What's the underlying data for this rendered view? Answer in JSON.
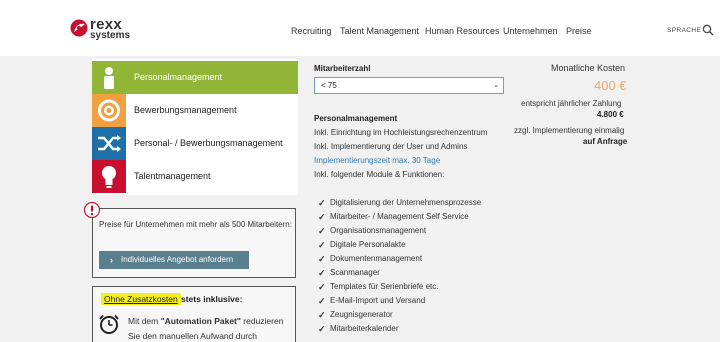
{
  "brand": {
    "name_line1": "rexx",
    "name_line2": "systems",
    "accent": "#c8102e"
  },
  "nav": {
    "items": [
      "Recruiting",
      "Talent Management",
      "Human Resources",
      "Unternehmen",
      "Preise"
    ],
    "language": "SPRACHE",
    "search_icon": "search-icon"
  },
  "modules": [
    {
      "label": "Personalmanagement",
      "icon": "person-icon",
      "color": "#91b637",
      "active": true
    },
    {
      "label": "Bewerbungsmanagement",
      "icon": "target-icon",
      "color": "#f0a040",
      "active": false
    },
    {
      "label": "Personal- / Bewerbungsmanagement",
      "icon": "shuffle-icon",
      "color": "#1f6fa8",
      "active": false
    },
    {
      "label": "Talentmanagement",
      "icon": "lightbulb-icon",
      "color": "#c8102e",
      "active": false
    }
  ],
  "info_box": {
    "text": "Preise für Unternehmen mit mehr als 500 Mitarbeitern:",
    "button_label": "Individuelles Angebot anfordern"
  },
  "included": {
    "highlight": "Ohne Zusatzkosten",
    "title_rest": "stets inklusive:",
    "text_prefix": "Mit dem ",
    "text_bold": "\"Automation Paket\"",
    "text_suffix": " reduzieren Sie den manuellen Aufwand durch Workflows,"
  },
  "middle": {
    "employee_label": "Mitarbeiterzahl",
    "employee_value": "< 75",
    "section_title": "Personalmanagement",
    "lines": [
      "Inkl. Einrichtung im Hochleistungsrechenzentrum",
      "Inkl. Implementierung der User und Admins",
      "Implementierungszeit max. 30 Tage",
      "Inkl. folgender Module & Funktionen:"
    ],
    "features": [
      "Digitalisierung der Unternehmensprozesse",
      "Mitarbeiter- / Management Self Service",
      "Organisationsmanagement",
      "Digitale Personalakte",
      "Dokumentenmanagement",
      "Scanmanager",
      "Templates für Serienbriefe etc.",
      "E-Mail-Import und Versand",
      "Zeugnisgenerator",
      "Mitarbeiterkalender"
    ]
  },
  "pricing": {
    "label": "Monatliche Kosten",
    "price": "400 €",
    "yearly_label": "entspricht jährlicher Zahlung",
    "yearly_value": "4.800 €",
    "impl_label": "zzgl. Implementierung einmalig",
    "impl_value": "auf Anfrage",
    "price_color": "#f0a868"
  }
}
